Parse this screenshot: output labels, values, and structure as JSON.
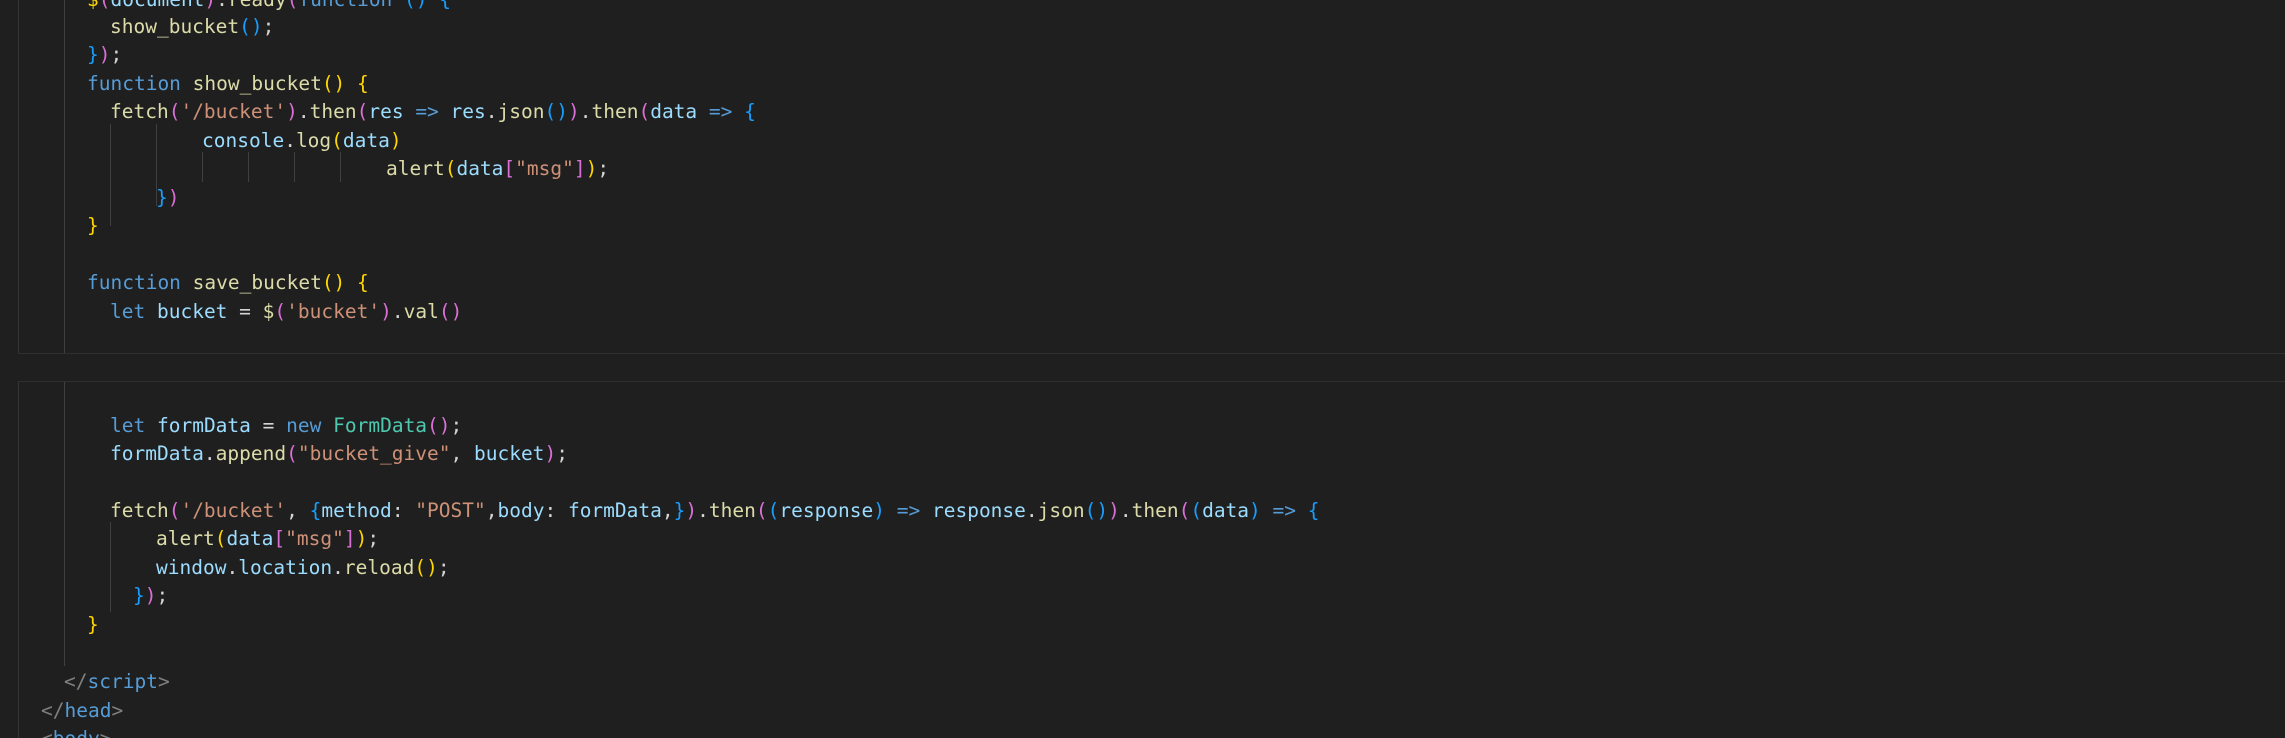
{
  "editor": {
    "lines": [
      {
        "text_a": "$(document).ready(function () {"
      },
      {
        "text": "show_bucket();"
      },
      {
        "text": "});"
      },
      {
        "kw": "function",
        "name": "show_bucket",
        "rest": "() {"
      },
      {
        "p1": "fetch(",
        "s1": "'/bucket'",
        "p2": ").then(",
        "v1": "res",
        "ar": " => ",
        "v2": "res",
        "p3": ".json()).then(",
        "v3": "data",
        "ar2": " => ",
        "p4": "{"
      },
      {
        "v": "console",
        "p": ".log(",
        "v2": "data",
        "p2": ")"
      },
      {
        "fn": "alert",
        "p": "(",
        "v": "data",
        "p2": "[",
        "s": "\"msg\"",
        "p3": "]);"
      },
      {
        "text": "})"
      },
      {
        "text": "}"
      },
      {
        "kw": "function",
        "name": "save_bucket",
        "rest": "() {"
      },
      {
        "kw": "let",
        "v": "bucket",
        "eq": " = ",
        "fn": "$",
        "p": "(",
        "s": "'bucket'",
        "p2": ").val()"
      },
      {
        "kw": "let",
        "v": "formData",
        "eq": " = ",
        "kw2": "new",
        "t": "FormData",
        "p": "();"
      },
      {
        "v": "formData",
        "p": ".append(",
        "s": "\"bucket_give\"",
        "p2": ", ",
        "v2": "bucket",
        "p3": ");"
      },
      {
        "p1": "fetch(",
        "s1": "'/bucket'",
        "p2": ", {",
        "v1": "method",
        "p3": ": ",
        "s2": "\"POST\"",
        "p4": ",",
        "v2": "body",
        "p5": ": ",
        "v3": "formData",
        "p6": ",}).then((",
        "v4": "response",
        "p7": ") => ",
        "v5": "response",
        "p8": ".json()).then((",
        "v6": "data",
        "p9": ") => {"
      },
      {
        "fn": "alert",
        "p": "(",
        "v": "data",
        "p2": "[",
        "s": "\"msg\"",
        "p3": "]);"
      },
      {
        "v": "window",
        "p": ".",
        "v2": "location",
        "p2": ".",
        "fn": "reload",
        "p3": "();"
      },
      {
        "text": "});"
      },
      {
        "text": "}"
      },
      {
        "open": "</",
        "tag": "script",
        "close": ">"
      },
      {
        "open": "</",
        "tag": "head",
        "close": ">"
      },
      {
        "open": "<",
        "tag": "body",
        "close": ">"
      }
    ]
  },
  "colors": {
    "background": "#1f1f1f",
    "keyword": "#569cd6",
    "function": "#dcdcaa",
    "string": "#ce9178",
    "variable": "#9cdcfe",
    "type": "#4ec9b0"
  }
}
